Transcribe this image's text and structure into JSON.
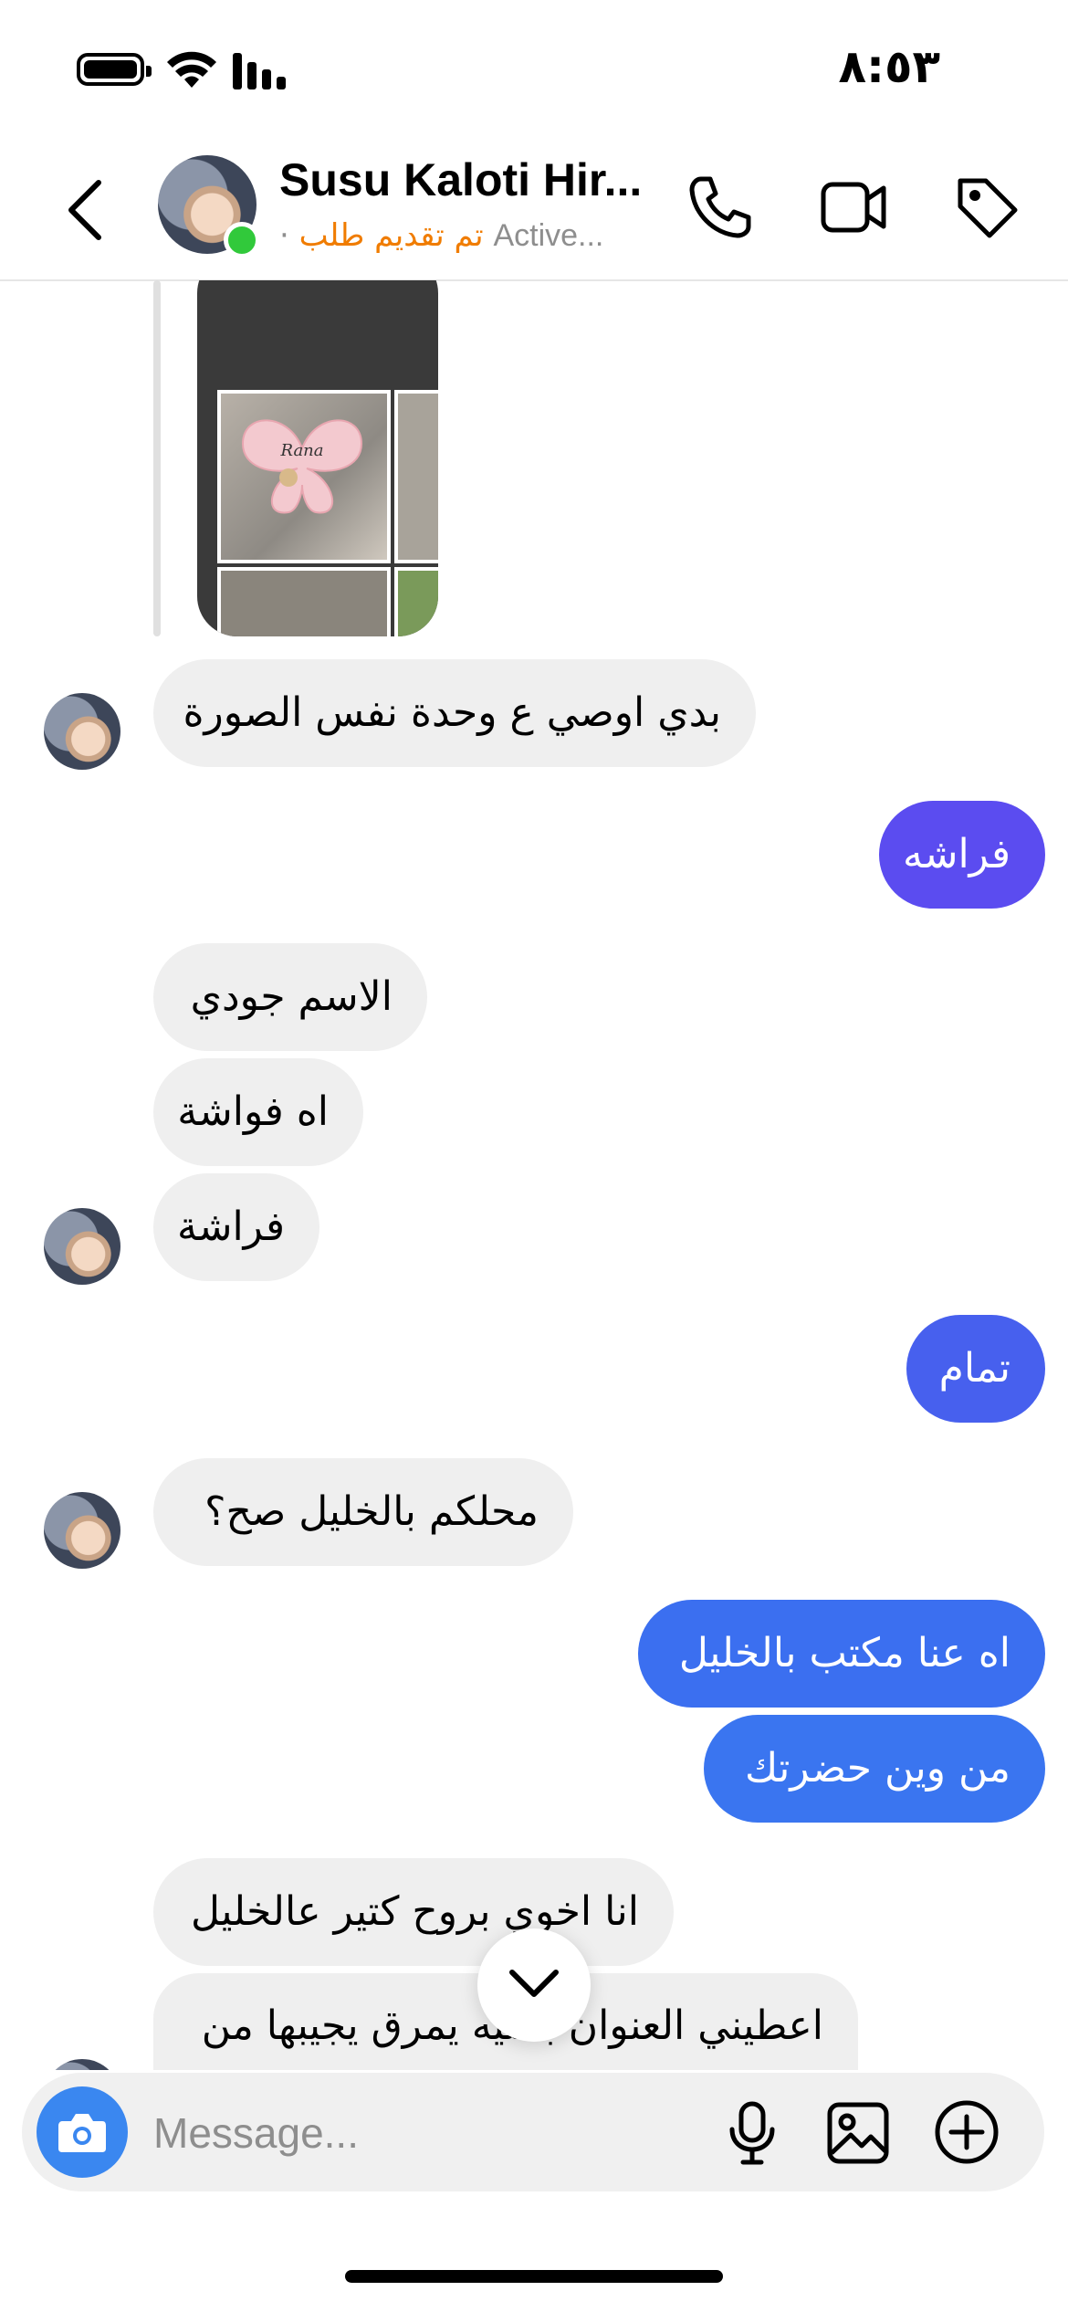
{
  "status_bar": {
    "time": "٨:٥٣"
  },
  "header": {
    "contact_name": "Susu Kaloti Hir...",
    "dot": "·",
    "tag_label": "تم تقديم طلب",
    "active_status": "Active..."
  },
  "messages": [
    {
      "from": "them",
      "text": "بدي اوصي ع وحدة نفس الصورة"
    },
    {
      "from": "me",
      "text": "فراشه"
    },
    {
      "from": "them",
      "text": "الاسم جودي"
    },
    {
      "from": "them",
      "text": "اه فواشة"
    },
    {
      "from": "them",
      "text": "فراشة"
    },
    {
      "from": "me",
      "text": "تمام"
    },
    {
      "from": "them",
      "text": "محلكم بالخليل صح؟"
    },
    {
      "from": "me",
      "text": "اه عنا مكتب بالخليل"
    },
    {
      "from": "me",
      "text": "من وين حضرتك"
    },
    {
      "from": "them",
      "text": "انا اخوي بروح كتير عالخليل"
    },
    {
      "from": "them",
      "text": "اعطيني العنوان بحليه يمرق يجيبها من"
    }
  ],
  "story_preview": {
    "overlay_text": "Rana"
  },
  "composer": {
    "placeholder": "Message..."
  },
  "colors": {
    "outgoing_purple": "#5b4cf0",
    "outgoing_blue": "#3a6ef0",
    "incoming_bg": "#efefef",
    "tag_orange": "#f07c00",
    "online_green": "#31c93b",
    "camera_blue": "#3a87f0"
  }
}
